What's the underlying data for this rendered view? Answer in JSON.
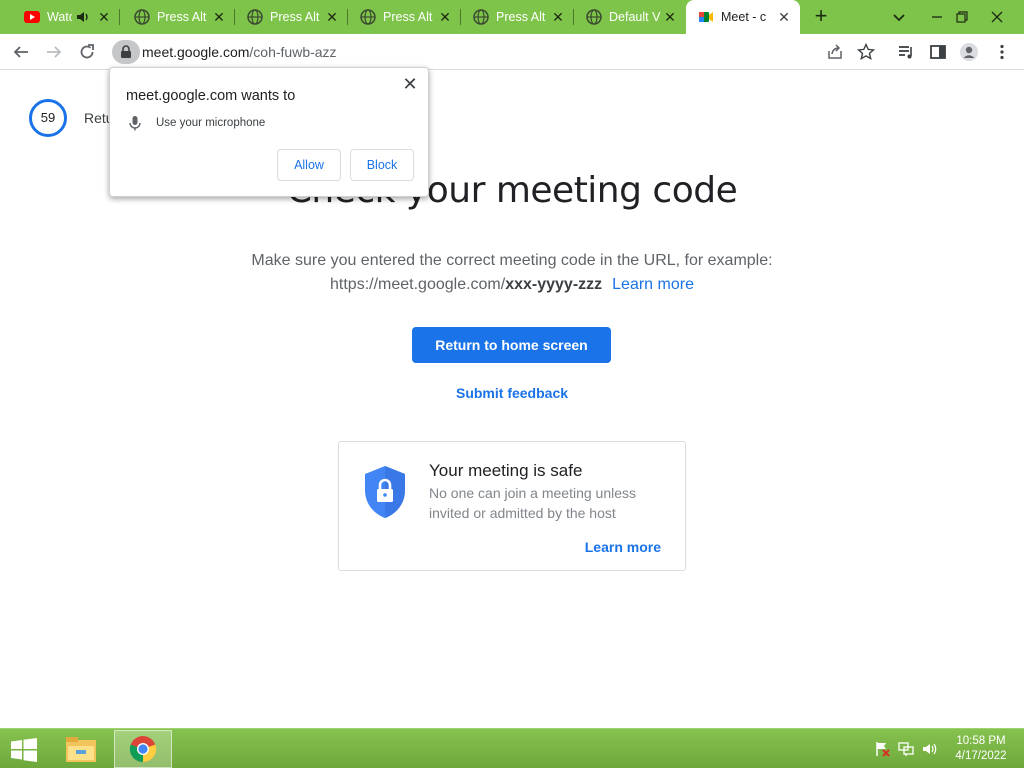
{
  "tabs": [
    {
      "title": "Watc",
      "icon": "youtube-icon",
      "audio": true
    },
    {
      "title": "Press Alt",
      "icon": "globe-icon"
    },
    {
      "title": "Press Alt",
      "icon": "globe-icon"
    },
    {
      "title": "Press Alt",
      "icon": "globe-icon"
    },
    {
      "title": "Press Alt",
      "icon": "globe-icon"
    },
    {
      "title": "Default V",
      "icon": "globe-icon"
    },
    {
      "title": "Meet - c",
      "icon": "google-meet-icon",
      "active": true
    }
  ],
  "toolbar": {
    "url_host": "meet.google.com",
    "url_path": "/coh-fuwb-azz"
  },
  "countdown": {
    "seconds": "59",
    "label": "Retu"
  },
  "main": {
    "heading": "Check your meeting code",
    "desc_line1": "Make sure you entered the correct meeting code in the URL, for example:",
    "desc_prefix": "https://meet.google.com/",
    "desc_example": "xxx-yyyy-zzz",
    "learn_more": "Learn more",
    "return_button": "Return to home screen",
    "submit_feedback": "Submit feedback"
  },
  "safe_card": {
    "title": "Your meeting is safe",
    "text": "No one can join a meeting unless invited or admitted by the host",
    "learn_more": "Learn more"
  },
  "permission": {
    "title": "meet.google.com wants to",
    "item": "Use your microphone",
    "allow": "Allow",
    "block": "Block"
  },
  "taskbar": {
    "time": "10:58 PM",
    "date": "4/17/2022"
  },
  "colors": {
    "accent": "#1a73e8",
    "tabstrip": "#7fc44a",
    "taskbar": "#7ab645"
  }
}
